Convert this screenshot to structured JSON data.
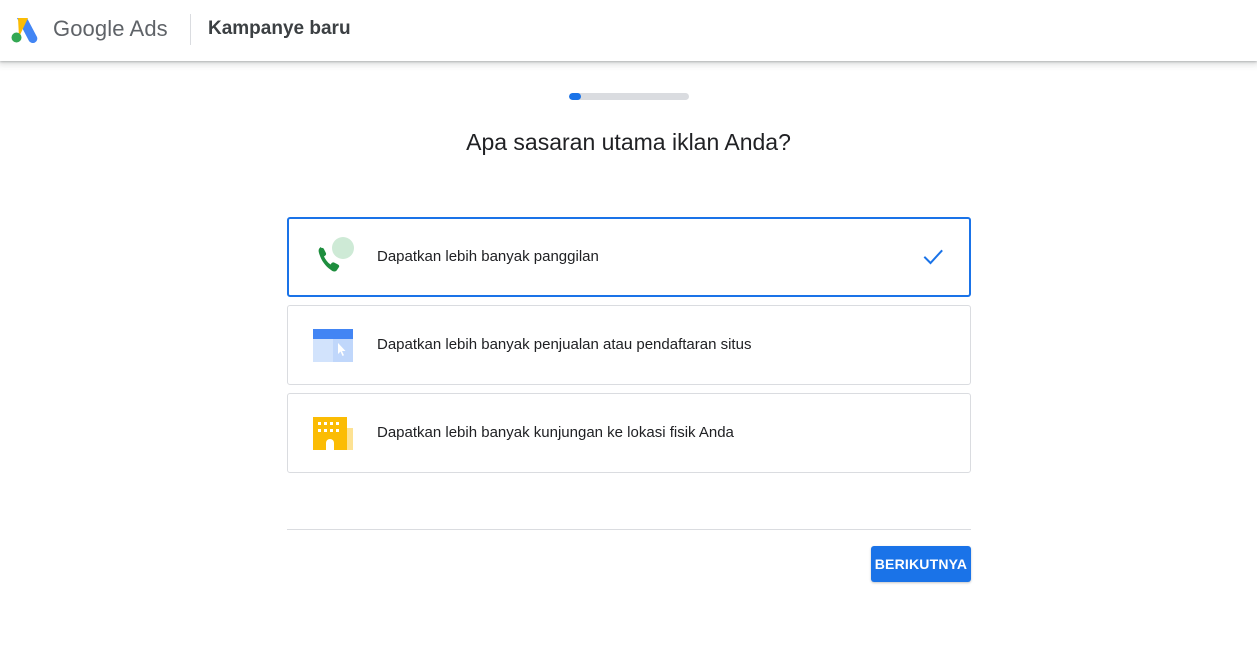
{
  "header": {
    "brand": "Google Ads",
    "page_title": "Kampanye baru"
  },
  "progress": {
    "fraction": 0.1
  },
  "question": "Apa sasaran utama iklan Anda?",
  "options": [
    {
      "label": "Dapatkan lebih banyak panggilan",
      "icon": "phone-call-icon",
      "selected": true
    },
    {
      "label": "Dapatkan lebih banyak penjualan atau pendaftaran situs",
      "icon": "website-click-icon",
      "selected": false
    },
    {
      "label": "Dapatkan lebih banyak kunjungan ke lokasi fisik Anda",
      "icon": "store-building-icon",
      "selected": false
    }
  ],
  "next_button": "BERIKUTNYA",
  "colors": {
    "accent": "#1a73e8",
    "logo_yellow": "#fbbc04",
    "logo_blue": "#4285f4",
    "logo_green": "#34a853"
  }
}
